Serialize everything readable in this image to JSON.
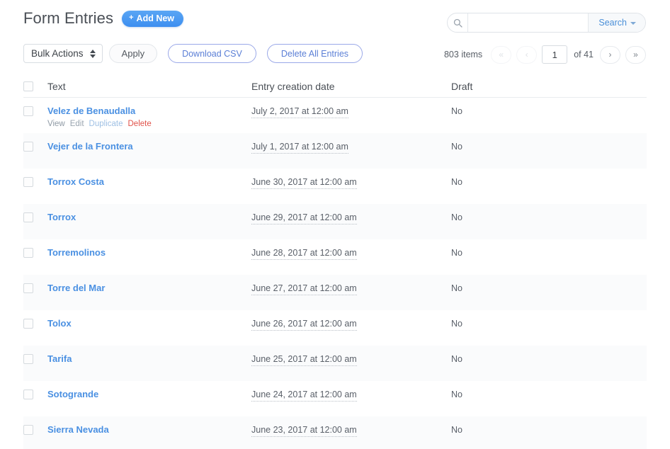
{
  "header": {
    "title": "Form Entries",
    "add_new_label": "Add New",
    "add_new_plus": "+"
  },
  "search": {
    "icon": "search-icon",
    "value": "",
    "placeholder": "",
    "button_label": "Search"
  },
  "toolbar": {
    "bulk_actions_label": "Bulk Actions",
    "apply_label": "Apply",
    "download_csv_label": "Download CSV",
    "delete_all_label": "Delete All Entries"
  },
  "pagination": {
    "items_count": "803 items",
    "first_label": "«",
    "prev_label": "‹",
    "current_page": "1",
    "of_label": "of 41",
    "next_label": "›",
    "last_label": "»"
  },
  "table": {
    "columns": {
      "text": "Text",
      "date": "Entry creation date",
      "draft": "Draft"
    },
    "row_actions": {
      "view": "View",
      "edit": "Edit",
      "duplicate": "Duplicate",
      "delete": "Delete"
    },
    "rows": [
      {
        "text": "Velez de Benaudalla",
        "date": "July 2, 2017 at 12:00 am",
        "draft": "No",
        "show_actions": true
      },
      {
        "text": "Vejer de la Frontera",
        "date": "July 1, 2017 at 12:00 am",
        "draft": "No",
        "show_actions": false
      },
      {
        "text": "Torrox Costa",
        "date": "June 30, 2017 at 12:00 am",
        "draft": "No",
        "show_actions": false
      },
      {
        "text": "Torrox",
        "date": "June 29, 2017 at 12:00 am",
        "draft": "No",
        "show_actions": false
      },
      {
        "text": "Torremolinos",
        "date": "June 28, 2017 at 12:00 am",
        "draft": "No",
        "show_actions": false
      },
      {
        "text": "Torre del Mar",
        "date": "June 27, 2017 at 12:00 am",
        "draft": "No",
        "show_actions": false
      },
      {
        "text": "Tolox",
        "date": "June 26, 2017 at 12:00 am",
        "draft": "No",
        "show_actions": false
      },
      {
        "text": "Tarifa",
        "date": "June 25, 2017 at 12:00 am",
        "draft": "No",
        "show_actions": false
      },
      {
        "text": "Sotogrande",
        "date": "June 24, 2017 at 12:00 am",
        "draft": "No",
        "show_actions": false
      },
      {
        "text": "Sierra Nevada",
        "date": "June 23, 2017 at 12:00 am",
        "draft": "No",
        "show_actions": false
      }
    ]
  },
  "colors": {
    "accent_blue": "#4a90e2",
    "outline_blue": "#5b7fd6",
    "delete_red": "#e0524a",
    "text_dark": "#4a4f56"
  }
}
